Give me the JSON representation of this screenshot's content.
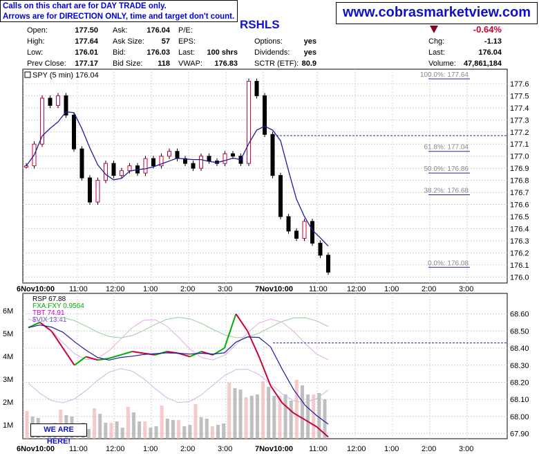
{
  "notice": {
    "line1": "Calls on this chart are for DAY TRADE only.",
    "line2": "Arrows are for DIRECTION ONLY, time and target don't count."
  },
  "site": "www.cobrasmarketview.com",
  "symbol": "RSHLS",
  "quote": {
    "open_label": "Open:",
    "open": "177.50",
    "high_label": "High:",
    "high": "177.64",
    "low_label": "Low:",
    "low": "176.01",
    "prev_label": "Prev Close:",
    "prev": "177.17",
    "ask_label": "Ask:",
    "ask": "176.04",
    "asksize_label": "Ask Size:",
    "asksize": "57",
    "bid_label": "Bid:",
    "bid": "176.03",
    "bidsize_label": "Bid Size:",
    "bidsize": "118",
    "pe_label": "P/E:",
    "pe": "",
    "eps_label": "EPS:",
    "eps": "",
    "last_label": "Last:",
    "last": "100 shrs",
    "vwap_label": "VWAP:",
    "vwap": "176.83",
    "options_label": "Options:",
    "options": "yes",
    "div_label": "Dividends:",
    "div": "yes",
    "sctr_label": "SCTR (ETF):",
    "sctr": "80.9",
    "change_pct": "-0.64%",
    "chg_label": "Chg:",
    "chg": "-1.13",
    "last2_label": "Last:",
    "last2": "176.04",
    "volume_label": "Volume:",
    "volume": "47,861,184"
  },
  "here_label": "WE ARE HERE!",
  "colors": {
    "up": "#cc0033",
    "down": "#000000",
    "ma": "#1a1aa0",
    "grid": "#d0d0d0",
    "fxa": "#00aa00",
    "tbt": "#cc00cc",
    "vix": "#7744cc",
    "accent": "#1010cc"
  },
  "chart_data": [
    {
      "type": "line",
      "panel": "price",
      "legend": "SPY (5 min) 176.04",
      "x_ticks": [
        "6Nov10:00",
        "11:00",
        "12:00",
        "1:00",
        "2:00",
        "3:00",
        "7Nov10:00",
        "11:00",
        "12:00",
        "1:00",
        "2:00",
        "3:00"
      ],
      "ylim": [
        175.95,
        177.72
      ],
      "y_ticks": [
        176.0,
        176.1,
        176.2,
        176.3,
        176.4,
        176.5,
        176.6,
        176.7,
        176.8,
        176.9,
        177.0,
        177.1,
        177.2,
        177.3,
        177.4,
        177.5,
        177.6
      ],
      "series": [
        {
          "values": [
            176.92,
            177.1,
            177.48,
            177.42,
            177.5,
            177.34,
            177.06,
            176.82,
            176.62,
            176.8,
            176.94,
            176.84,
            176.88,
            176.92,
            176.86,
            176.98,
            176.92,
            177.0,
            177.04,
            176.98,
            176.94,
            176.9,
            177.0,
            176.96,
            176.94,
            177.02,
            177.0,
            176.94,
            177.62,
            177.5,
            177.18,
            176.84,
            176.5,
            176.38,
            176.32,
            176.46,
            176.28,
            176.18,
            176.04
          ]
        }
      ],
      "annotations": [
        {
          "label": "100.0%: 177.64",
          "value": 177.64
        },
        {
          "label": "61.8%: 177.04",
          "value": 177.04
        },
        {
          "label": "50.0%: 176.86",
          "value": 176.86
        },
        {
          "label": "38.2%: 176.68",
          "value": 176.68
        },
        {
          "label": "0.0%: 176.08",
          "value": 176.08
        }
      ],
      "reference_line": 177.17
    },
    {
      "type": "line",
      "panel": "indicator",
      "legend": [
        {
          "label": "RSP 67.88",
          "color": "#000000"
        },
        {
          "label": "FXA:FXY 0.9564",
          "color": "#00aa00"
        },
        {
          "label": "TBT 74.91",
          "color": "#cc00cc"
        },
        {
          "label": "$VIX 13.41",
          "color": "#7744cc"
        }
      ],
      "x_ticks": [
        "6Nov10:00",
        "11:00",
        "12:00",
        "1:00",
        "2:00",
        "3:00",
        "7Nov10:00",
        "11:00",
        "12:00",
        "1:00",
        "2:00",
        "3:00"
      ],
      "ylim": [
        67.87,
        68.72
      ],
      "y_ticks": [
        67.9,
        68.0,
        68.1,
        68.2,
        68.3,
        68.4,
        68.5,
        68.6
      ],
      "volume_ticks": [
        "1M",
        "2M",
        "3M",
        "4M",
        "5M",
        "6M"
      ],
      "series": [
        {
          "name": "RSP",
          "values": [
            68.52,
            68.55,
            68.5,
            68.4,
            68.3,
            68.35,
            68.33,
            68.34,
            68.36,
            68.38,
            68.37,
            68.36,
            68.38,
            68.37,
            68.35,
            68.38,
            68.36,
            68.4,
            68.6,
            68.5,
            68.35,
            68.18,
            68.08,
            68.02,
            67.98,
            67.94,
            67.88
          ]
        }
      ]
    }
  ]
}
